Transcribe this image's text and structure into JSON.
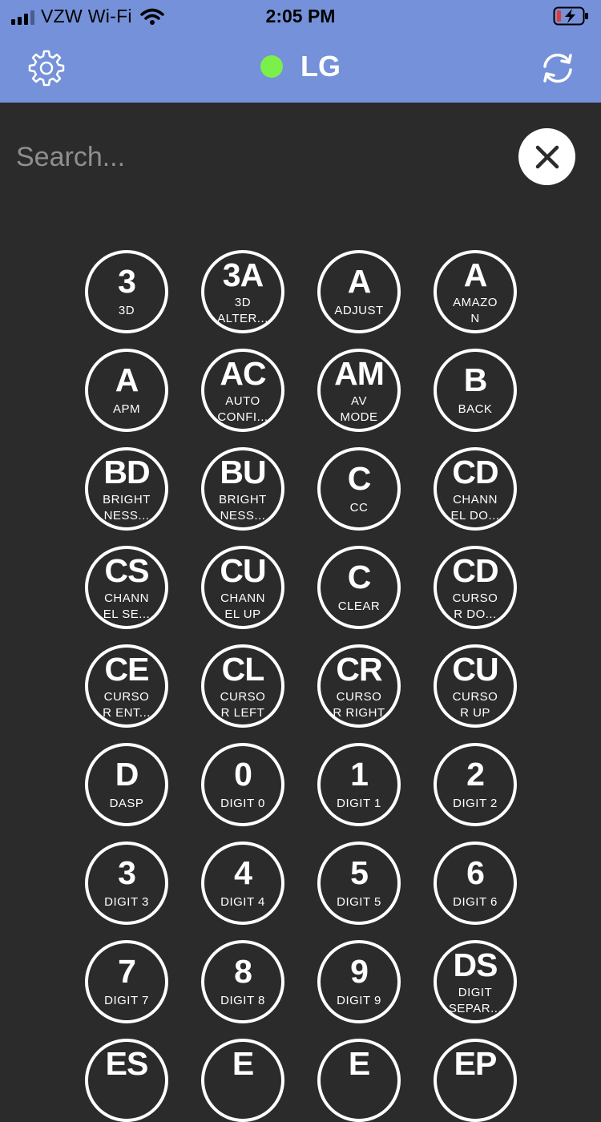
{
  "status_bar": {
    "carrier": "VZW Wi-Fi",
    "time": "2:05 PM"
  },
  "nav": {
    "title": "LG",
    "connection_color": "#7cf04a"
  },
  "search": {
    "placeholder": "Search..."
  },
  "colors": {
    "bar": "#7591d9",
    "background": "#2b2b2b"
  },
  "buttons": [
    {
      "abbr": "3",
      "label": "3D"
    },
    {
      "abbr": "3A",
      "label": "3D\nALTER..."
    },
    {
      "abbr": "A",
      "label": "ADJUST"
    },
    {
      "abbr": "A",
      "label": "AMAZO\nN"
    },
    {
      "abbr": "A",
      "label": "APM"
    },
    {
      "abbr": "AC",
      "label": "AUTO\nCONFI..."
    },
    {
      "abbr": "AM",
      "label": "AV\nMODE"
    },
    {
      "abbr": "B",
      "label": "BACK"
    },
    {
      "abbr": "BD",
      "label": "BRIGHT\nNESS..."
    },
    {
      "abbr": "BU",
      "label": "BRIGHT\nNESS..."
    },
    {
      "abbr": "C",
      "label": "CC"
    },
    {
      "abbr": "CD",
      "label": "CHANN\nEL DO..."
    },
    {
      "abbr": "CS",
      "label": "CHANN\nEL SE..."
    },
    {
      "abbr": "CU",
      "label": "CHANN\nEL UP"
    },
    {
      "abbr": "C",
      "label": "CLEAR"
    },
    {
      "abbr": "CD",
      "label": "CURSO\nR DO..."
    },
    {
      "abbr": "CE",
      "label": "CURSO\nR ENT..."
    },
    {
      "abbr": "CL",
      "label": "CURSO\nR LEFT"
    },
    {
      "abbr": "CR",
      "label": "CURSO\nR RIGHT"
    },
    {
      "abbr": "CU",
      "label": "CURSO\nR UP"
    },
    {
      "abbr": "D",
      "label": "DASP"
    },
    {
      "abbr": "0",
      "label": "DIGIT 0"
    },
    {
      "abbr": "1",
      "label": "DIGIT 1"
    },
    {
      "abbr": "2",
      "label": "DIGIT 2"
    },
    {
      "abbr": "3",
      "label": "DIGIT 3"
    },
    {
      "abbr": "4",
      "label": "DIGIT 4"
    },
    {
      "abbr": "5",
      "label": "DIGIT 5"
    },
    {
      "abbr": "6",
      "label": "DIGIT 6"
    },
    {
      "abbr": "7",
      "label": "DIGIT 7"
    },
    {
      "abbr": "8",
      "label": "DIGIT 8"
    },
    {
      "abbr": "9",
      "label": "DIGIT 9"
    },
    {
      "abbr": "DS",
      "label": "DIGIT\nSEPAR..."
    },
    {
      "abbr": "ES",
      "label": ""
    },
    {
      "abbr": "E",
      "label": ""
    },
    {
      "abbr": "E",
      "label": ""
    },
    {
      "abbr": "EP",
      "label": ""
    }
  ]
}
